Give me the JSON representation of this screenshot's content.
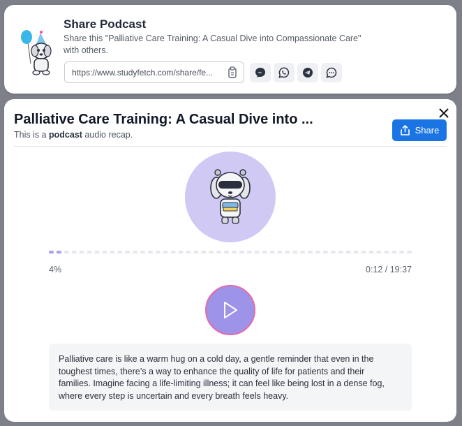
{
  "share_panel": {
    "title": "Share Podcast",
    "description": "Share this \"Palliative Care Training: A Casual Dive into Compassionate Care\" with others.",
    "link": "https://www.studyfetch.com/share/fe...",
    "socials": [
      "messenger-icon",
      "whatsapp-icon",
      "telegram-icon",
      "chat-icon"
    ]
  },
  "modal": {
    "title": "Palliative Care Training: A Casual Dive into ...",
    "subtitle_prefix": "This is a ",
    "subtitle_bold": "podcast",
    "subtitle_suffix": " audio recap.",
    "share_label": "Share",
    "progress_percent_label": "4%",
    "progress": 0.04,
    "time": "0:12 / 19:37",
    "transcript": "Palliative care is like a warm hug on a cold day, a gentle reminder that even in the toughest times, there’s a way to enhance the quality of life for patients and their families. Imagine facing a life-limiting illness; it can feel like being lost in a dense fog, where every step is uncertain and every breath feels heavy."
  },
  "colors": {
    "accent": "#1b74e4",
    "avatar_bg": "#cfc9f4",
    "play_bg": "#9d93e8",
    "play_ring": "#e86aa8",
    "progress_fill": "#a9a1ee",
    "progress_empty": "#e7e8ee"
  }
}
